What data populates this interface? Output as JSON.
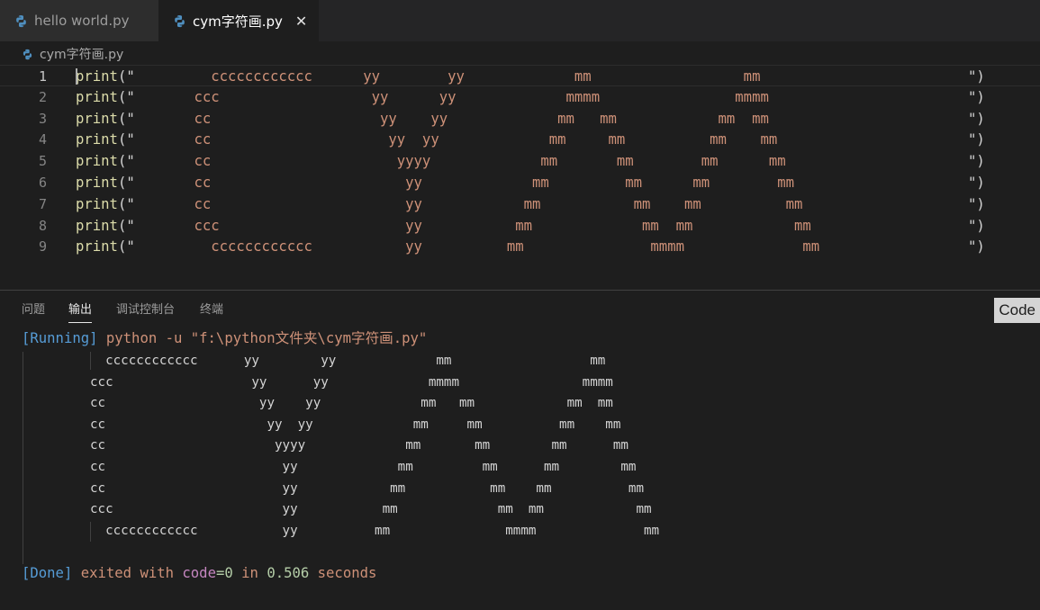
{
  "tabs": [
    {
      "label": "hello world.py",
      "active": false
    },
    {
      "label": "cym字符画.py",
      "active": true,
      "close": "✕"
    }
  ],
  "breadcrumb": {
    "file": "cym字符画.py"
  },
  "editor": {
    "keyword": "print",
    "open": "(\"",
    "close": "\")",
    "lines": [
      {
        "num": "1",
        "text": "         cccccccccccc      yy        yy             mm                  mm"
      },
      {
        "num": "2",
        "text": "       ccc                  yy      yy             mmmm                mmmm"
      },
      {
        "num": "3",
        "text": "       cc                    yy    yy             mm   mm            mm  mm"
      },
      {
        "num": "4",
        "text": "       cc                     yy  yy             mm     mm          mm    mm"
      },
      {
        "num": "5",
        "text": "       cc                      yyyy             mm       mm        mm      mm"
      },
      {
        "num": "6",
        "text": "       cc                       yy             mm         mm      mm        mm"
      },
      {
        "num": "7",
        "text": "       cc                       yy            mm           mm    mm          mm"
      },
      {
        "num": "8",
        "text": "       ccc                      yy           mm             mm  mm            mm"
      },
      {
        "num": "9",
        "text": "         cccccccccccc           yy          mm               mmmm              mm"
      }
    ]
  },
  "panel": {
    "tabs": [
      "问题",
      "输出",
      "调试控制台",
      "终端"
    ],
    "active_tab": "输出",
    "badge": "Code",
    "running_tag": "[Running]",
    "command": " python -u \"f:\\python文件夹\\cym字符画.py\"",
    "art": [
      "  cccccccccccc      yy        yy             mm                  mm",
      "ccc                  yy      yy             mmmm                mmmm",
      "cc                    yy    yy             mm   mm            mm  mm",
      "cc                     yy  yy             mm     mm          mm    mm",
      "cc                      yyyy             mm       mm        mm      mm",
      "cc                       yy             mm         mm      mm        mm",
      "cc                       yy            mm           mm    mm          mm",
      "ccc                      yy           mm             mm  mm            mm",
      "  cccccccccccc           yy          mm               mmmm              mm"
    ],
    "done": {
      "tag": "[Done]",
      "text1": " exited with ",
      "code_word": "code",
      "eq": "=0",
      "text2": " in ",
      "seconds": "0.506",
      "text3": " seconds"
    }
  },
  "colors": {
    "background": "#1e1e1e",
    "string": "#ce9178",
    "function": "#dcdcaa",
    "keyword_blue": "#569cd6"
  }
}
